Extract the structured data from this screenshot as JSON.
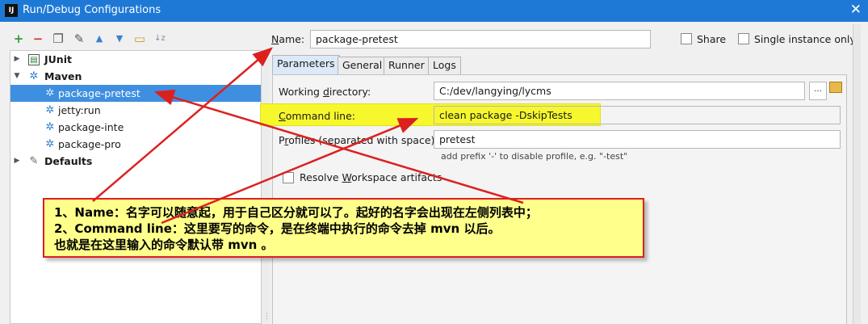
{
  "window": {
    "app_icon_text": "IJ",
    "title": "Run/Debug Configurations",
    "close_glyph": "✕"
  },
  "toolbar": {
    "icons": [
      {
        "name": "add-icon",
        "glyph": "+",
        "color": "#3a9a3a"
      },
      {
        "name": "remove-icon",
        "glyph": "−",
        "color": "#d23a2a"
      },
      {
        "name": "copy-icon",
        "glyph": "❐",
        "color": "#555555"
      },
      {
        "name": "wrench-icon",
        "glyph": "✎",
        "color": "#555555"
      },
      {
        "name": "move-up-icon",
        "glyph": "▲",
        "color": "#3b7fd0"
      },
      {
        "name": "move-down-icon",
        "glyph": "▼",
        "color": "#3b7fd0"
      },
      {
        "name": "folder-icon",
        "glyph": "▭",
        "color": "#c89a2a"
      },
      {
        "name": "sort-icon",
        "glyph": "↓z",
        "color": "#888888"
      }
    ]
  },
  "tree": {
    "junit": "JUnit",
    "maven": "Maven",
    "items": [
      "package-pretest",
      "jetty:run",
      "package-inte",
      "package-pro"
    ],
    "defaults": "Defaults"
  },
  "header": {
    "name_label_first": "N",
    "name_label_rest": "ame:",
    "name_value": "package-pretest",
    "share_label": "Share",
    "single_instance_label": "Single instance only"
  },
  "tabs": [
    "Parameters",
    "General",
    "Runner",
    "Logs"
  ],
  "form": {
    "working_dir_label_a": "Working ",
    "working_dir_label_u": "d",
    "working_dir_label_b": "irectory:",
    "working_dir_value": "C:/dev/langying/lycms",
    "browse_label": "...",
    "command_label_u": "C",
    "command_label_rest": "ommand line:",
    "command_value": "clean package -DskipTests",
    "profiles_label_a": "P",
    "profiles_label_u": "r",
    "profiles_label_b": "ofiles (separated with space):",
    "profiles_value": "pretest",
    "profiles_hint": "add prefix '-' to disable profile, e.g. \"-test\"",
    "resolve_label_a": "Resolve ",
    "resolve_label_u": "W",
    "resolve_label_b": "orkspace artifacts"
  },
  "annotation": {
    "line1": "1、Name：名字可以随意起，用于自己区分就可以了。起好的名字会出现在左侧列表中；",
    "line2": "2、Command line：这里要写的命令，是在终端中执行的命令去掉 mvn 以后。",
    "line3": "也就是在这里输入的命令默认带 mvn 。"
  },
  "colors": {
    "titlebar": "#1e79d6",
    "selection": "#3f8fe0",
    "highlight": "#f7f72e",
    "arrow": "#dc2020"
  }
}
